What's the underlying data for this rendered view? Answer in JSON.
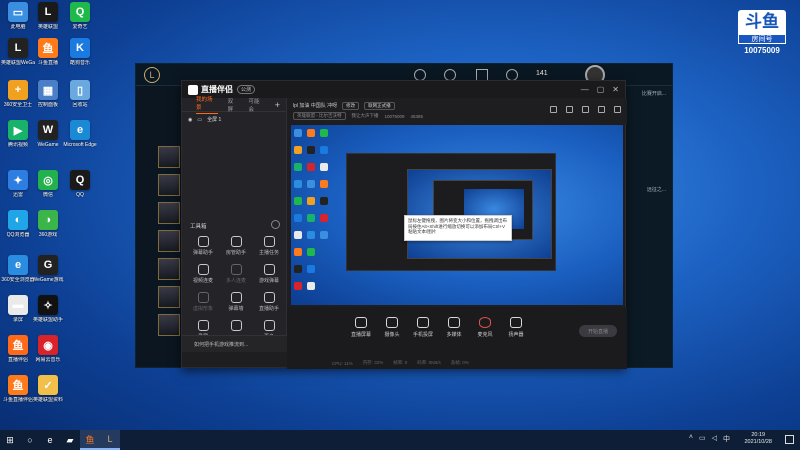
{
  "watermark": {
    "logo": "斗鱼",
    "sub": "房间号",
    "room_id": "10075009"
  },
  "desktop_icons": [
    {
      "label": "此电脑",
      "color": "#3a8fe0",
      "glyph": "▭"
    },
    {
      "label": "英雄联盟",
      "color": "#1a1a1a",
      "glyph": "L"
    },
    {
      "label": "爱奇艺",
      "color": "#1fb84b",
      "glyph": "Q"
    },
    {
      "label": "英雄联盟WeGame版",
      "color": "#222",
      "glyph": "L"
    },
    {
      "label": "斗鱼直播",
      "color": "#ff7a1a",
      "glyph": "鱼"
    },
    {
      "label": "酷狗音乐",
      "color": "#1a7ae0",
      "glyph": "K"
    },
    {
      "label": "360安全卫士",
      "color": "#f2a01f",
      "glyph": "+"
    },
    {
      "label": "控制面板",
      "color": "#4a7fc8",
      "glyph": "▦"
    },
    {
      "label": "回收站",
      "color": "#6aa8e0",
      "glyph": "▯"
    },
    {
      "label": "腾讯视频",
      "color": "#18b26a",
      "glyph": "▶"
    },
    {
      "label": "WeGame",
      "color": "#222",
      "glyph": "W"
    },
    {
      "label": "Microsoft Edge",
      "color": "#1b8ad6",
      "glyph": "e"
    },
    {
      "label": "迅雷",
      "color": "#2d7ee0",
      "glyph": "✦"
    },
    {
      "label": "微信",
      "color": "#22b14c",
      "glyph": "◎"
    },
    {
      "label": "QQ",
      "color": "#1a1a1a",
      "glyph": "Q"
    },
    {
      "label": "QQ浏览器",
      "color": "#1fa5e8",
      "glyph": "◐"
    },
    {
      "label": "360游戏",
      "color": "#39b54a",
      "glyph": "◑"
    },
    {
      "label": "360安全浏览器",
      "color": "#2a8de0",
      "glyph": "e"
    },
    {
      "label": "WeGame游戏",
      "color": "#222",
      "glyph": "G"
    },
    {
      "label": "录屏",
      "color": "#eaeaea",
      "glyph": "▬"
    },
    {
      "label": "英雄联盟助手",
      "color": "#111",
      "glyph": "✧"
    },
    {
      "label": "直播伴侣",
      "color": "#ff6a1a",
      "glyph": "鱼"
    },
    {
      "label": "网易云音乐",
      "color": "#d8232a",
      "glyph": "◉"
    },
    {
      "label": "斗鱼直播伴侣",
      "color": "#ff7a1a",
      "glyph": "鱼"
    },
    {
      "label": "英雄联盟资料",
      "color": "#f0c04a",
      "glyph": "✓"
    }
  ],
  "game": {
    "coins": "141",
    "right_texts": [
      "比赛开启...",
      "远征之..."
    ]
  },
  "app": {
    "title": "直播伴侣",
    "version": "公测",
    "tabs": [
      "我的场景",
      "双屏",
      "可能会"
    ],
    "scene_name": "全屏 1",
    "tools_title": "工具箱",
    "tools": [
      {
        "label": "弹幕助手",
        "dim": false
      },
      {
        "label": "房管助手",
        "dim": false
      },
      {
        "label": "主播任务",
        "dim": false
      },
      {
        "label": "视频连麦",
        "dim": false
      },
      {
        "label": "多人连麦",
        "dim": true
      },
      {
        "label": "游戏弹幕",
        "dim": false
      },
      {
        "label": "虚拟形象",
        "dim": true
      },
      {
        "label": "弹幕墙",
        "dim": false
      },
      {
        "label": "直播助手",
        "dim": false
      },
      {
        "label": "录屏",
        "dim": false
      },
      {
        "label": "",
        "dim": false
      },
      {
        "label": "更多",
        "dim": false
      }
    ],
    "tip": "如何把手机游戏推流到...",
    "room_title": "lpl 加油 中国队 冲呀",
    "tag_edit": "修改",
    "tag_broadcast": "联网正式播",
    "category": "英雄联盟 - 比尔吉沃特",
    "room_name": "我让大声下播",
    "room_no": "10075009",
    "viewers": "45385",
    "popup_text": "鼠标左键拖拽，图片将变大小和位置，拖拽调出布局按住Alt+Shift进行缩放切换可以添加布局Ctrl+V粘贴文本/图片",
    "bottom_buttons": [
      "直播屏幕",
      "摄像头",
      "手机投屏",
      "多媒体",
      "麦克风",
      "扬声器"
    ],
    "start_label": "开始直播",
    "status": [
      "CPU: 11%",
      "内存: 32%",
      "帧率: 0",
      "码率: 0KB/s",
      "丢帧: 0%"
    ]
  },
  "taskbar": {
    "time": "20:19",
    "date": "2021/10/28",
    "lang": "中"
  }
}
